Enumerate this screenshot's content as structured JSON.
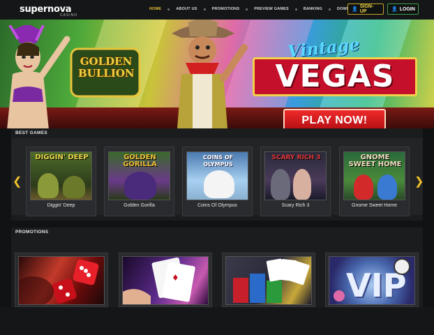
{
  "brand": {
    "name": "supernova",
    "sub": "CASINO"
  },
  "nav": {
    "items": [
      "HOME",
      "ABOUT US",
      "PROMOTIONS",
      "PREVIEW GAMES",
      "BANKING",
      "DOWNLOAD"
    ],
    "active_index": 0,
    "signup_label": "SIGN-UP",
    "login_label": "LOGIN"
  },
  "hero": {
    "golden_bullion": "GOLDEN BULLION",
    "vintage": "Vintage",
    "vegas": "VEGAS",
    "play_now": "PLAY NOW!"
  },
  "best_games": {
    "title": "BEST GAMES",
    "items": [
      {
        "name": "Diggin' Deep",
        "logo": "DIGGIN' DEEP"
      },
      {
        "name": "Golden Gorilla",
        "logo": "GOLDEN GORILLA"
      },
      {
        "name": "Coins Of Olympus",
        "logo": "COINS OF OLYMPUS"
      },
      {
        "name": "Scary Rich 3",
        "logo": "SCARY RICH 3"
      },
      {
        "name": "Gnome Sweet Home",
        "logo": "GNOME SWEET HOME"
      }
    ]
  },
  "promotions": {
    "title": "PROMOTIONS",
    "items": [
      {
        "kind": "dice"
      },
      {
        "kind": "cards"
      },
      {
        "kind": "chips"
      },
      {
        "kind": "vip",
        "text": "VIP"
      }
    ]
  },
  "colors": {
    "accent_gold": "#e8c43a",
    "signup_border": "#c9a52a",
    "login_border": "#3fa24a",
    "play_red": "#d41a20"
  }
}
